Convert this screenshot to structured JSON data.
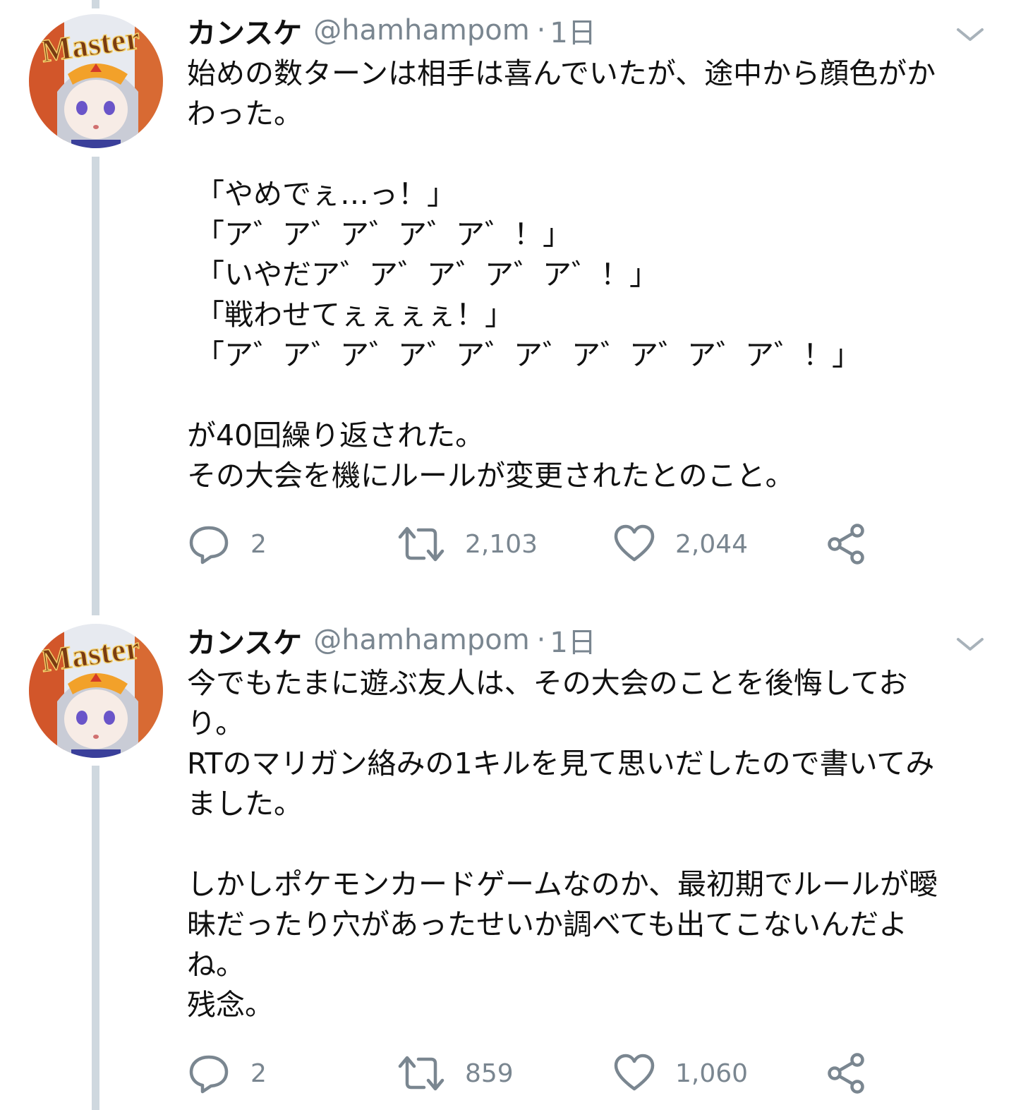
{
  "tweets": [
    {
      "name": "カンスケ",
      "handle": "@hamhampom",
      "separator": "·",
      "time": "1日",
      "avatar_text": "Master",
      "lines": [
        "始めの数ターンは相手は喜んでいたが、途中から顔色がか",
        "わった。",
        "",
        "「やめでぇ…っ！」",
        "「ア゛ア゛ア゛ア゛ア゛！」",
        "「いやだア゛ア゛ア゛ア゛ア゛！」",
        "「戦わせてぇぇぇぇ！」",
        "「ア゛ア゛ア゛ア゛ア゛ア゛ア゛ア゛ア゛ア゛！」",
        "",
        "が40回繰り返された。",
        "その大会を機にルールが変更されたとのこと。"
      ],
      "replies": "2",
      "retweets": "2,103",
      "likes": "2,044"
    },
    {
      "name": "カンスケ",
      "handle": "@hamhampom",
      "separator": "·",
      "time": "1日",
      "avatar_text": "Master",
      "lines": [
        "今でもたまに遊ぶ友人は、その大会のことを後悔してお",
        "り。",
        "RTのマリガン絡みの1キルを見て思いだしたので書いてみ",
        "ました。",
        "",
        "しかしポケモンカードゲームなのか、最初期でルールが曖",
        "昧だったり穴があったせいか調べても出てこないんだよ",
        "ね。",
        "残念。"
      ],
      "replies": "2",
      "retweets": "859",
      "likes": "1,060"
    }
  ],
  "colors": {
    "meta_gray": "#7a8690",
    "thread_line": "#cfd8df",
    "text": "#111111"
  }
}
